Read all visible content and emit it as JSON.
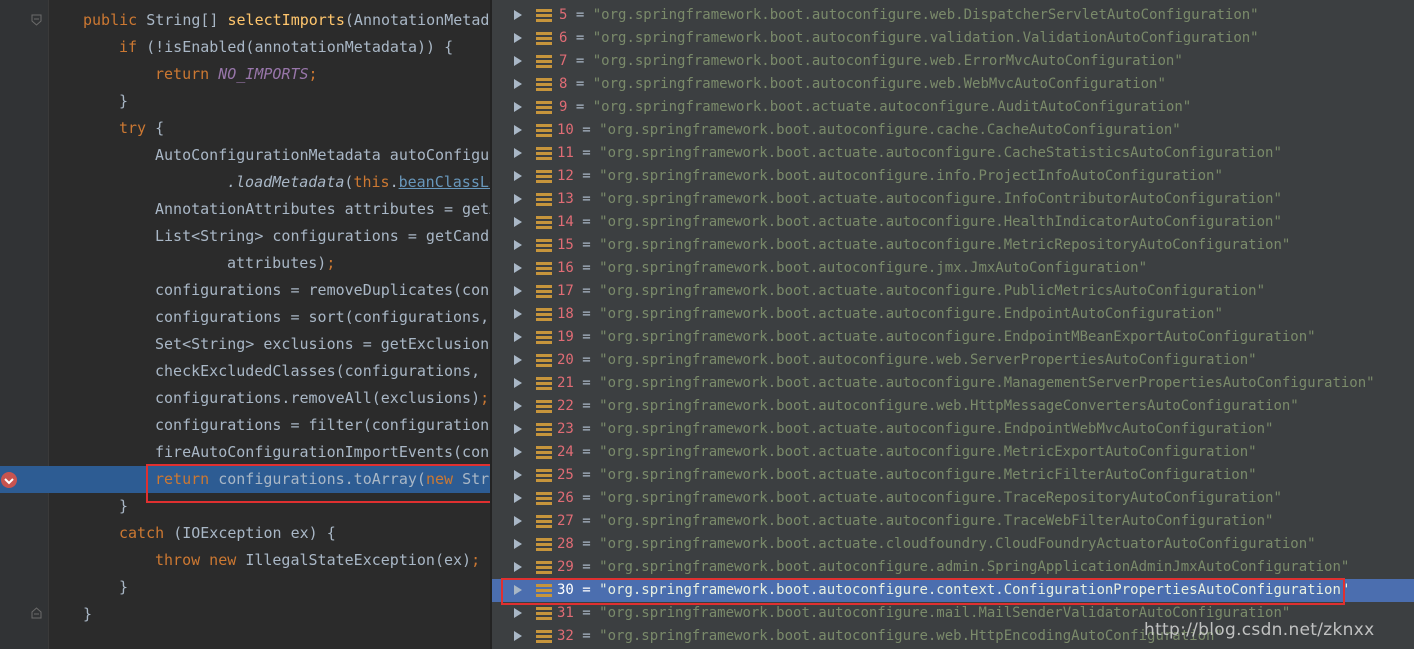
{
  "editor": {
    "lines": [
      [
        [
          "kw",
          "public "
        ],
        [
          "",
          "String[] "
        ],
        [
          "fn",
          "selectImports"
        ],
        [
          "",
          "(AnnotationMetada"
        ]
      ],
      [
        [
          "kw",
          "if "
        ],
        [
          "",
          "(!isEnabled(annotationMetadata)) {"
        ]
      ],
      [
        [
          "kw",
          "return "
        ],
        [
          "it",
          "NO_IMPORTS"
        ],
        [
          "sc",
          ";"
        ]
      ],
      [
        [
          "",
          "}"
        ]
      ],
      [
        [
          "kw",
          "try "
        ],
        [
          "",
          "{"
        ]
      ],
      [
        [
          "",
          "AutoConfigurationMetadata autoConfigu"
        ]
      ],
      [
        [
          "itf",
          ".loadMetadata"
        ],
        [
          "",
          "("
        ],
        [
          "kw",
          "this"
        ],
        [
          "",
          "."
        ],
        [
          "lnk",
          "beanClassLo"
        ]
      ],
      [
        [
          "",
          "AnnotationAttributes attributes = getA"
        ]
      ],
      [
        [
          "",
          "List<String> configurations = getCandi"
        ]
      ],
      [
        [
          "",
          "attributes)"
        ],
        [
          "sc",
          ";"
        ]
      ],
      [
        [
          "",
          "configurations = removeDuplicates(conf"
        ]
      ],
      [
        [
          "",
          "configurations = sort(configurations, "
        ]
      ],
      [
        [
          "",
          "Set<String> exclusions = getExclusions"
        ]
      ],
      [
        [
          "",
          "checkExcludedClasses(configurations, e"
        ]
      ],
      [
        [
          "",
          "configurations.removeAll(exclusions)"
        ],
        [
          "sc",
          ";"
        ]
      ],
      [
        [
          "",
          "configurations = filter(configurations"
        ]
      ],
      [
        [
          "",
          "fireAutoConfigurationImportEvents(conf"
        ]
      ],
      [
        [
          "kw",
          "return "
        ],
        [
          "hlf",
          "configurations.toArray("
        ],
        [
          "kw",
          "new "
        ],
        [
          "hlf",
          "Str"
        ]
      ],
      [
        [
          "",
          "}"
        ]
      ],
      [
        [
          "kw",
          "catch "
        ],
        [
          "",
          "(IOException ex) {"
        ]
      ],
      [
        [
          "kw",
          "throw new "
        ],
        [
          "",
          "IllegalStateException(ex)"
        ],
        [
          "sc",
          ";"
        ]
      ],
      [
        [
          "",
          "}"
        ]
      ],
      [
        [
          "",
          "}"
        ]
      ]
    ],
    "indents": [
      0,
      1,
      2,
      1,
      1,
      2,
      4,
      2,
      2,
      4,
      2,
      2,
      2,
      2,
      2,
      2,
      2,
      2,
      1,
      1,
      2,
      1,
      0
    ],
    "highlighted_line": 17
  },
  "variables": {
    "rows": [
      {
        "index": "5",
        "value": "\"org.springframework.boot.autoconfigure.web.DispatcherServletAutoConfiguration\""
      },
      {
        "index": "6",
        "value": "\"org.springframework.boot.autoconfigure.validation.ValidationAutoConfiguration\""
      },
      {
        "index": "7",
        "value": "\"org.springframework.boot.autoconfigure.web.ErrorMvcAutoConfiguration\""
      },
      {
        "index": "8",
        "value": "\"org.springframework.boot.autoconfigure.web.WebMvcAutoConfiguration\""
      },
      {
        "index": "9",
        "value": "\"org.springframework.boot.actuate.autoconfigure.AuditAutoConfiguration\""
      },
      {
        "index": "10",
        "value": "\"org.springframework.boot.autoconfigure.cache.CacheAutoConfiguration\""
      },
      {
        "index": "11",
        "value": "\"org.springframework.boot.actuate.autoconfigure.CacheStatisticsAutoConfiguration\""
      },
      {
        "index": "12",
        "value": "\"org.springframework.boot.autoconfigure.info.ProjectInfoAutoConfiguration\""
      },
      {
        "index": "13",
        "value": "\"org.springframework.boot.actuate.autoconfigure.InfoContributorAutoConfiguration\""
      },
      {
        "index": "14",
        "value": "\"org.springframework.boot.actuate.autoconfigure.HealthIndicatorAutoConfiguration\""
      },
      {
        "index": "15",
        "value": "\"org.springframework.boot.actuate.autoconfigure.MetricRepositoryAutoConfiguration\""
      },
      {
        "index": "16",
        "value": "\"org.springframework.boot.autoconfigure.jmx.JmxAutoConfiguration\""
      },
      {
        "index": "17",
        "value": "\"org.springframework.boot.actuate.autoconfigure.PublicMetricsAutoConfiguration\""
      },
      {
        "index": "18",
        "value": "\"org.springframework.boot.actuate.autoconfigure.EndpointAutoConfiguration\""
      },
      {
        "index": "19",
        "value": "\"org.springframework.boot.actuate.autoconfigure.EndpointMBeanExportAutoConfiguration\""
      },
      {
        "index": "20",
        "value": "\"org.springframework.boot.autoconfigure.web.ServerPropertiesAutoConfiguration\""
      },
      {
        "index": "21",
        "value": "\"org.springframework.boot.actuate.autoconfigure.ManagementServerPropertiesAutoConfiguration\""
      },
      {
        "index": "22",
        "value": "\"org.springframework.boot.autoconfigure.web.HttpMessageConvertersAutoConfiguration\""
      },
      {
        "index": "23",
        "value": "\"org.springframework.boot.actuate.autoconfigure.EndpointWebMvcAutoConfiguration\""
      },
      {
        "index": "24",
        "value": "\"org.springframework.boot.actuate.autoconfigure.MetricExportAutoConfiguration\""
      },
      {
        "index": "25",
        "value": "\"org.springframework.boot.actuate.autoconfigure.MetricFilterAutoConfiguration\""
      },
      {
        "index": "26",
        "value": "\"org.springframework.boot.actuate.autoconfigure.TraceRepositoryAutoConfiguration\""
      },
      {
        "index": "27",
        "value": "\"org.springframework.boot.actuate.autoconfigure.TraceWebFilterAutoConfiguration\""
      },
      {
        "index": "28",
        "value": "\"org.springframework.boot.actuate.cloudfoundry.CloudFoundryActuatorAutoConfiguration\""
      },
      {
        "index": "29",
        "value": "\"org.springframework.boot.autoconfigure.admin.SpringApplicationAdminJmxAutoConfiguration\""
      },
      {
        "index": "30",
        "value": "\"org.springframework.boot.autoconfigure.context.ConfigurationPropertiesAutoConfiguration\""
      },
      {
        "index": "31",
        "value": "\"org.springframework.boot.autoconfigure.mail.MailSenderValidatorAutoConfiguration\""
      },
      {
        "index": "32",
        "value": "\"org.springframework.boot.autoconfigure.web.HttpEncodingAutoConfiguration\""
      }
    ],
    "selected_index": "30"
  },
  "watermark": "http://blog.csdn.net/zknxx",
  "colors": {
    "keyword": "#cc7832",
    "method": "#ffc66d",
    "constant": "#9876aa",
    "selection": "#4b6eaf",
    "highlight_box": "#e03030"
  }
}
